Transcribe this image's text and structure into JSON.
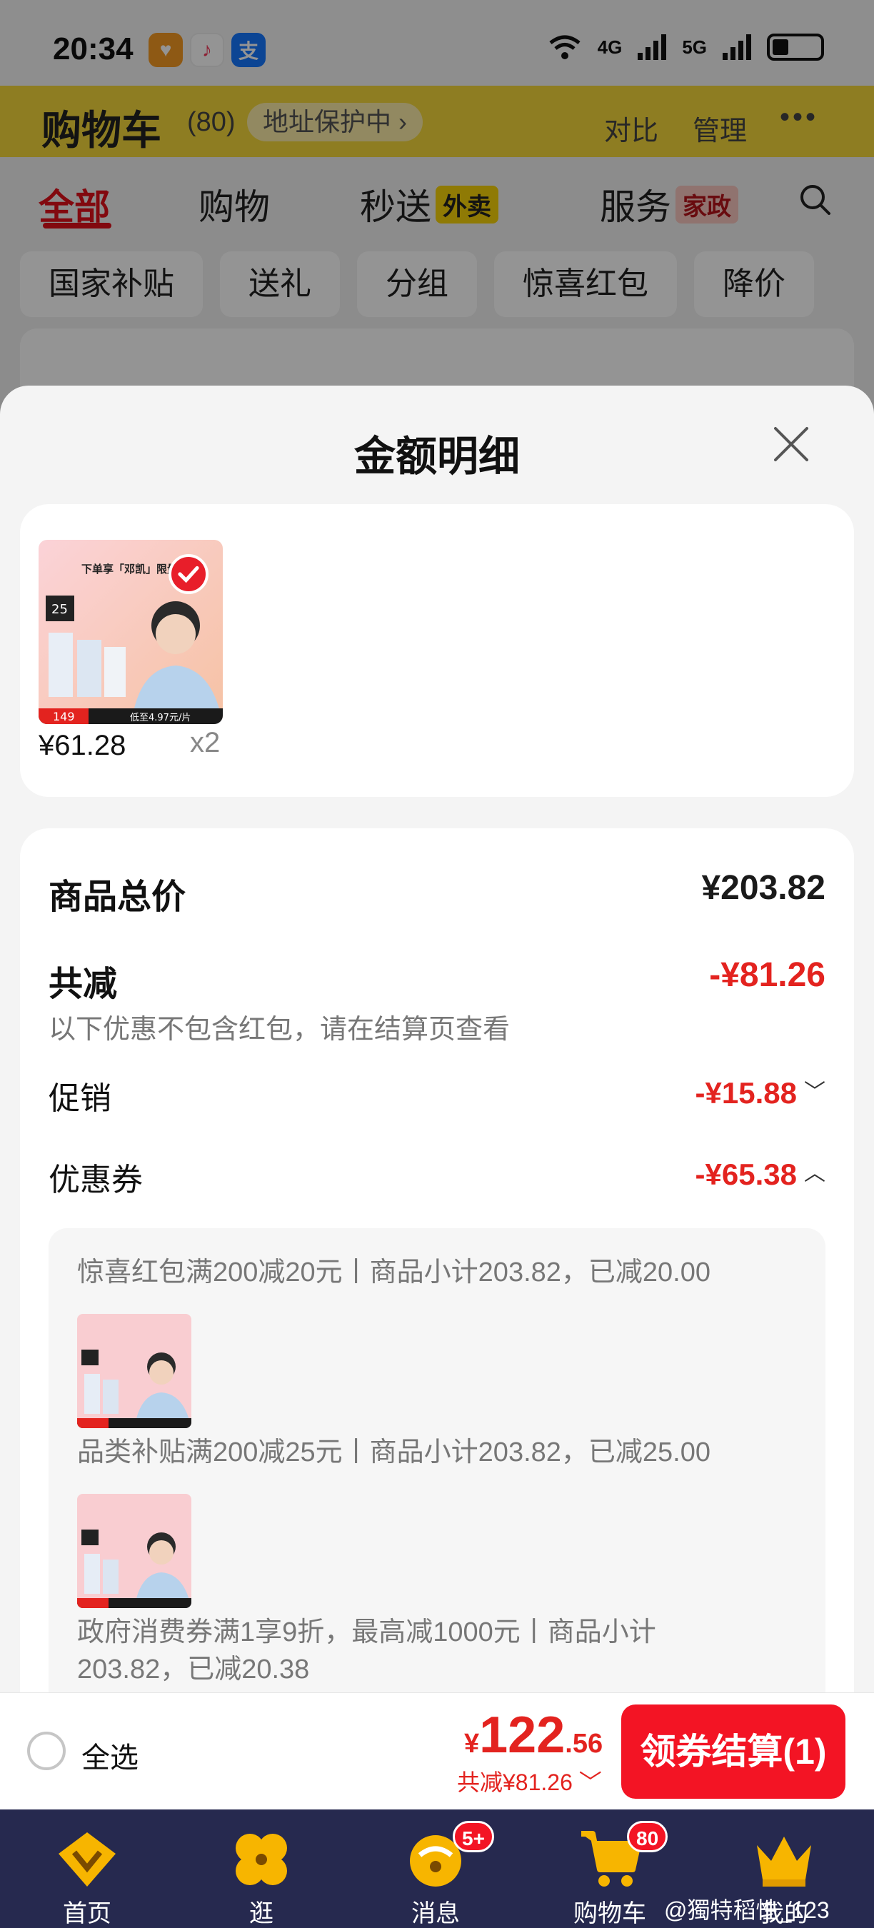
{
  "status_bar": {
    "time": "20:34",
    "network_1": "4G",
    "network_2": "5G"
  },
  "background": {
    "cart_title": "购物车",
    "cart_count": "(80)",
    "address_pill": "地址保护中 ›",
    "compare": "对比",
    "manage": "管理",
    "more": "•••",
    "tabs": [
      {
        "label": "全部",
        "badge": ""
      },
      {
        "label": "购物",
        "badge": ""
      },
      {
        "label": "秒送",
        "badge": "外卖"
      },
      {
        "label": "服务",
        "badge": "家政"
      }
    ],
    "chips": [
      "国家补贴",
      "送礼",
      "分组",
      "惊喜红包",
      "降价"
    ]
  },
  "sheet": {
    "title": "金额明细",
    "item": {
      "price": "¥61.28",
      "qty": "x2",
      "image_caption": "下单享「邓凯」限量周边",
      "image_price": "149",
      "image_footer": "低至4.97元/片",
      "image_badge": "25"
    },
    "total_label": "商品总价",
    "total_value": "¥203.82",
    "discount_label": "共减",
    "discount_value": "-¥81.26",
    "discount_note": "以下优惠不包含红包，请在结算页查看",
    "promo_label": "促销",
    "promo_value": "-¥15.88",
    "coupon_label": "优惠券",
    "coupon_value": "-¥65.38",
    "coupons": [
      "惊喜红包满200减20元丨商品小计203.82，已减20.00",
      "品类补贴满200减25元丨商品小计203.82，已减25.00",
      "政府消费券满1享9折，最高减1000元丨商品小计203.82，已减20.38"
    ]
  },
  "checkout": {
    "select_all": "全选",
    "currency": "¥",
    "total_int": "122",
    "total_dec": ".56",
    "saved": "共减¥81.26",
    "button": "领券结算(1)"
  },
  "nav": {
    "items": [
      {
        "label": "首页",
        "badge": ""
      },
      {
        "label": "逛",
        "badge": ""
      },
      {
        "label": "消息",
        "badge": "5+"
      },
      {
        "label": "购物车",
        "badge": "80"
      },
      {
        "label": "我的",
        "badge": ""
      }
    ]
  },
  "watermark": "@獨特稻性_123",
  "colors": {
    "accent_red": "#e3231f",
    "button_red": "#f31424",
    "nav_bg": "#26294f",
    "header_yellow": "#f5d83c"
  },
  "icons": [
    "wifi-icon",
    "signal-icon",
    "battery-icon",
    "search-icon",
    "close-icon",
    "check-icon",
    "home-icon",
    "browse-icon",
    "message-icon",
    "cart-icon",
    "profile-icon"
  ]
}
